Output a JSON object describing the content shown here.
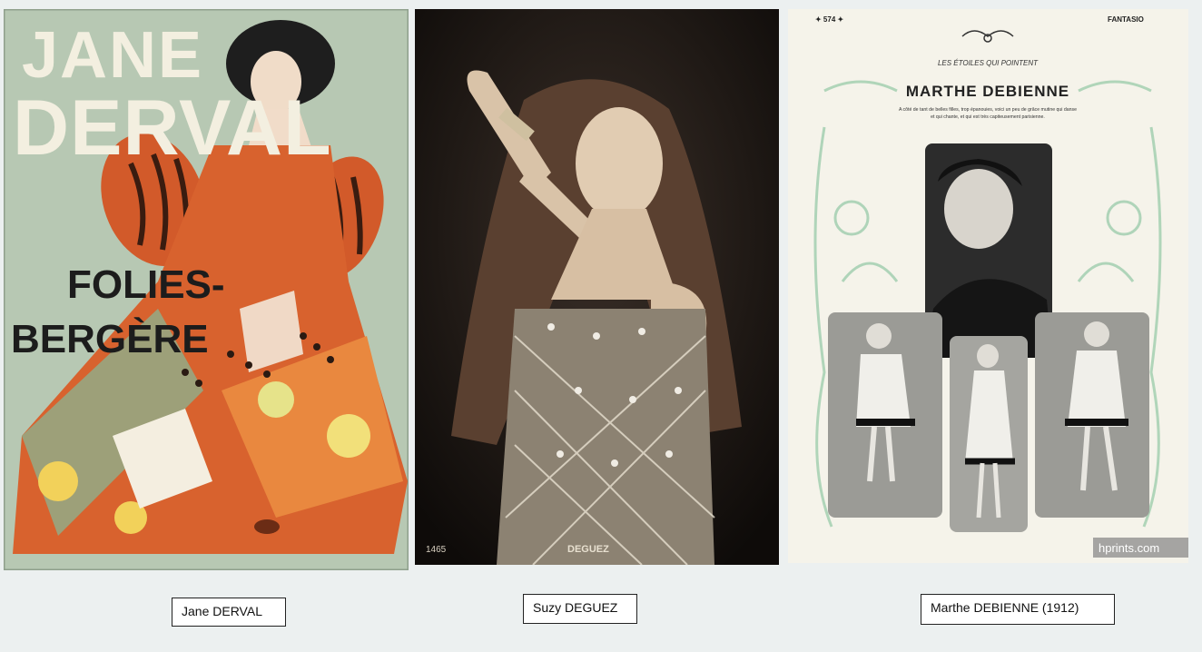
{
  "panels": [
    {
      "poster_title_line1": "JANE",
      "poster_title_line2": "DERVAL",
      "poster_venue_line1": "FOLIES-",
      "poster_venue_line2": "BERGÈRE",
      "caption": "Jane DERVAL"
    },
    {
      "photo_number": "1465",
      "photo_name": "DEGUEZ",
      "caption": "Suzy DEGUEZ"
    },
    {
      "page_number": "✦ 574 ✦",
      "magazine": "FANTASIO",
      "section": "LES ÉTOILES QUI POINTENT",
      "headline": "MARTHE DEBIENNE",
      "blurb_line1": "A côté de tant de belles filles, trop épanouies, voici un peu de grâce mutine qui danse",
      "blurb_line2": "et qui chante, et qui est très capiteusement parisienne.",
      "watermark": "hprints.com",
      "caption": "Marthe DEBIENNE (1912)"
    }
  ]
}
